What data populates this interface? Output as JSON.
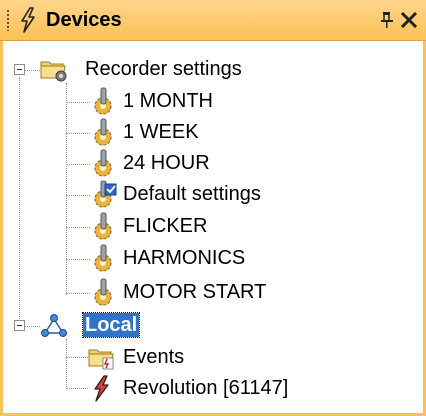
{
  "panel": {
    "title": "Devices",
    "pin_glyph": "ᵖ",
    "close_glyph": "✕",
    "title_icon": "lightning-bolt-icon",
    "accent": "#fbc155"
  },
  "tree": {
    "recorder_settings": {
      "label": "Recorder settings",
      "icon": "folder-settings-icon",
      "items": [
        {
          "label": "1 MONTH",
          "icon": "gear-wrench-icon"
        },
        {
          "label": "1 WEEK",
          "icon": "gear-wrench-icon"
        },
        {
          "label": "24 HOUR",
          "icon": "gear-wrench-icon"
        },
        {
          "label": "Default settings",
          "icon": "gear-wrench-checked-icon"
        },
        {
          "label": "FLICKER",
          "icon": "gear-wrench-icon"
        },
        {
          "label": "HARMONICS",
          "icon": "gear-wrench-icon"
        },
        {
          "label": "MOTOR START",
          "icon": "gear-wrench-icon"
        }
      ]
    },
    "local": {
      "label": "Local",
      "icon": "network-icon",
      "selected": true,
      "selection_color": "#3173c6",
      "items": [
        {
          "label": "Events",
          "icon": "folder-events-icon"
        },
        {
          "label": "Revolution [61147]",
          "icon": "lightning-bolt-icon"
        }
      ]
    }
  }
}
